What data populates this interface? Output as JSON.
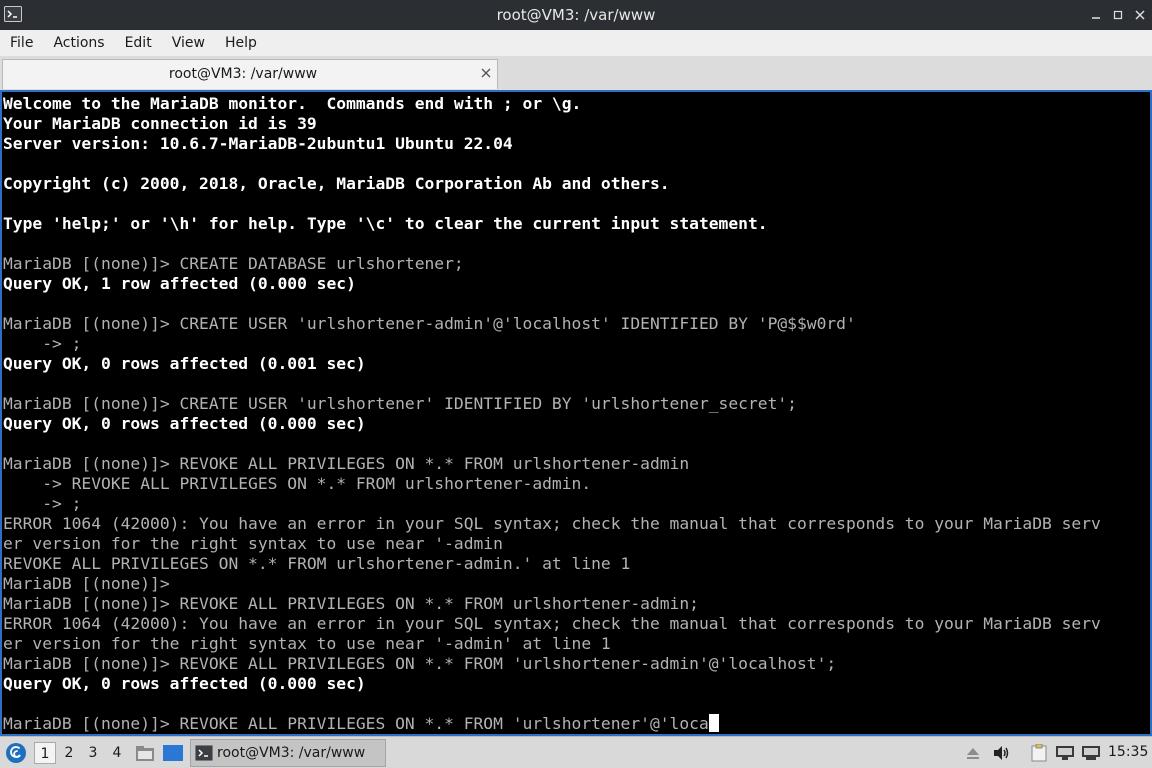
{
  "window": {
    "title": "root@VM3: /var/www",
    "controls": [
      "minimize-icon",
      "maximize-icon",
      "close-icon"
    ]
  },
  "menubar": {
    "items": [
      "File",
      "Actions",
      "Edit",
      "View",
      "Help"
    ]
  },
  "tabs": [
    {
      "label": "root@VM3: /var/www",
      "close_icon": "close-icon"
    }
  ],
  "terminal": {
    "lines": [
      {
        "text": "Welcome to the MariaDB monitor.  Commands end with ; or \\g.",
        "style": "bold"
      },
      {
        "text": "Your MariaDB connection id is 39",
        "style": "bold"
      },
      {
        "text": "Server version: 10.6.7-MariaDB-2ubuntu1 Ubuntu 22.04",
        "style": "bold"
      },
      {
        "text": "",
        "style": "normal"
      },
      {
        "text": "Copyright (c) 2000, 2018, Oracle, MariaDB Corporation Ab and others.",
        "style": "bold"
      },
      {
        "text": "",
        "style": "normal"
      },
      {
        "text": "Type 'help;' or '\\h' for help. Type '\\c' to clear the current input statement.",
        "style": "bold"
      },
      {
        "text": "",
        "style": "normal"
      },
      {
        "text": "MariaDB [(none)]> CREATE DATABASE urlshortener;",
        "style": "normal"
      },
      {
        "text": "Query OK, 1 row affected (0.000 sec)",
        "style": "bold"
      },
      {
        "text": "",
        "style": "normal"
      },
      {
        "text": "MariaDB [(none)]> CREATE USER 'urlshortener-admin'@'localhost' IDENTIFIED BY 'P@$$w0rd'",
        "style": "normal"
      },
      {
        "text": "    -> ;",
        "style": "normal"
      },
      {
        "text": "Query OK, 0 rows affected (0.001 sec)",
        "style": "bold"
      },
      {
        "text": "",
        "style": "normal"
      },
      {
        "text": "MariaDB [(none)]> CREATE USER 'urlshortener' IDENTIFIED BY 'urlshortener_secret';",
        "style": "normal"
      },
      {
        "text": "Query OK, 0 rows affected (0.000 sec)",
        "style": "bold"
      },
      {
        "text": "",
        "style": "normal"
      },
      {
        "text": "MariaDB [(none)]> REVOKE ALL PRIVILEGES ON *.* FROM urlshortener-admin",
        "style": "normal"
      },
      {
        "text": "    -> REVOKE ALL PRIVILEGES ON *.* FROM urlshortener-admin.",
        "style": "normal"
      },
      {
        "text": "    -> ;",
        "style": "normal"
      },
      {
        "text": "ERROR 1064 (42000): You have an error in your SQL syntax; check the manual that corresponds to your MariaDB serv",
        "style": "normal"
      },
      {
        "text": "er version for the right syntax to use near '-admin",
        "style": "normal"
      },
      {
        "text": "REVOKE ALL PRIVILEGES ON *.* FROM urlshortener-admin.' at line 1",
        "style": "normal"
      },
      {
        "text": "MariaDB [(none)]>",
        "style": "normal"
      },
      {
        "text": "MariaDB [(none)]> REVOKE ALL PRIVILEGES ON *.* FROM urlshortener-admin;",
        "style": "normal"
      },
      {
        "text": "ERROR 1064 (42000): You have an error in your SQL syntax; check the manual that corresponds to your MariaDB serv",
        "style": "normal"
      },
      {
        "text": "er version for the right syntax to use near '-admin' at line 1",
        "style": "normal"
      },
      {
        "text": "MariaDB [(none)]> REVOKE ALL PRIVILEGES ON *.* FROM 'urlshortener-admin'@'localhost';",
        "style": "normal"
      },
      {
        "text": "Query OK, 0 rows affected (0.000 sec)",
        "style": "bold"
      },
      {
        "text": "",
        "style": "normal"
      },
      {
        "text": "MariaDB [(none)]> REVOKE ALL PRIVILEGES ON *.* FROM 'urlshortener'@'loca",
        "style": "normal",
        "cursor": true
      }
    ]
  },
  "taskbar": {
    "start_icon": "debian-swirl-icon",
    "workspaces": [
      {
        "label": "1",
        "active": true
      },
      {
        "label": "2",
        "active": false
      },
      {
        "label": "3",
        "active": false
      },
      {
        "label": "4",
        "active": false
      }
    ],
    "launchers": [
      "file-manager-icon",
      "show-desktop-icon"
    ],
    "tasks": [
      {
        "label": "root@VM3: /var/www",
        "icon": "terminal-icon"
      }
    ],
    "tray": [
      "eject-icon",
      "volume-icon",
      "clipboard-icon",
      "network-icon",
      "monitor-icon"
    ],
    "clock": "15:35"
  },
  "colors": {
    "titlebar": "#2b2e33",
    "terminal_bg": "#000000",
    "terminal_border": "#2d6fc7",
    "terminal_text": "#b2b2b2",
    "terminal_bold": "#ffffff",
    "panel": "#d9d9d9"
  }
}
